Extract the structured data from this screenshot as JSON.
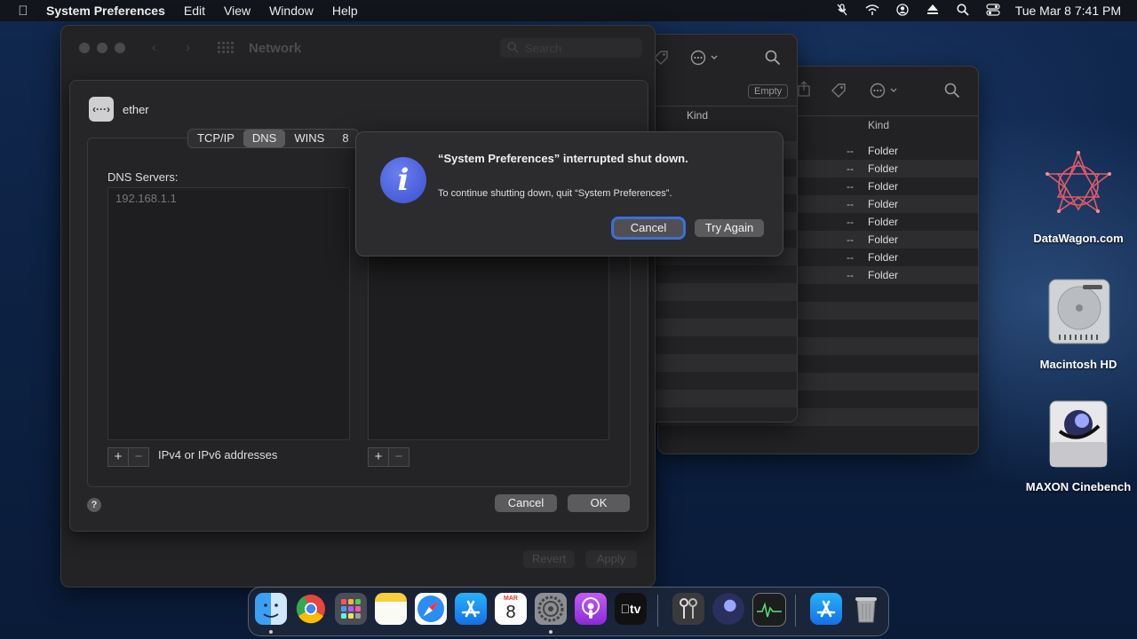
{
  "menubar": {
    "app_name": "System Preferences",
    "items": [
      "Edit",
      "View",
      "Window",
      "Help"
    ],
    "clock": "Tue Mar 8  7:41 PM",
    "status_icons": [
      "mic-muted-icon",
      "wifi-icon",
      "user-icon",
      "eject-icon",
      "spotlight-icon",
      "control-center-icon"
    ]
  },
  "network_window": {
    "title": "Network",
    "search_placeholder": "Search",
    "revert_label": "Revert",
    "apply_label": "Apply"
  },
  "sheet": {
    "interface_name": "ether",
    "tabs": [
      "TCP/IP",
      "DNS",
      "WINS",
      "8"
    ],
    "selected_tab": "DNS",
    "dns_servers_label": "DNS Servers:",
    "dns_servers": [
      "192.168.1.1"
    ],
    "address_hint": "IPv4 or IPv6 addresses",
    "cancel_label": "Cancel",
    "ok_label": "OK",
    "help_label": "?"
  },
  "finder_back": {
    "empty_label": "Empty",
    "kind_header": "Kind",
    "rows": [
      {
        "size": "--",
        "kind": "Folder"
      },
      {
        "size": "--",
        "kind": "Folder"
      },
      {
        "size": "--",
        "kind": "Folder"
      },
      {
        "size": "--",
        "kind": "Folder"
      },
      {
        "size": "--",
        "kind": "Folder"
      },
      {
        "size": "--",
        "kind": "Folder"
      },
      {
        "size": "--",
        "kind": "Folder"
      },
      {
        "size": "--",
        "kind": "Folder"
      }
    ]
  },
  "alert": {
    "title": "“System Preferences” interrupted shut down.",
    "message": "To continue shutting down, quit “System Preferences”.",
    "cancel_label": "Cancel",
    "try_again_label": "Try Again",
    "icon_glyph": "i"
  },
  "desktop": {
    "icons": [
      {
        "label": "DataWagon.com",
        "icon": "datawagon-logo-icon"
      },
      {
        "label": "Macintosh HD",
        "icon": "hard-drive-icon"
      },
      {
        "label": "MAXON Cinebench",
        "icon": "cinebench-disk-icon"
      }
    ]
  },
  "dock": {
    "calendar_month": "MAR",
    "calendar_day": "8",
    "tv_label": "tv",
    "apps": [
      "finder",
      "chrome",
      "launchpad",
      "notes",
      "safari",
      "app-store",
      "calendar",
      "system-preferences",
      "podcasts",
      "apple-tv",
      "keychain-access",
      "cinebench",
      "activity-monitor",
      "app-store-downloads",
      "trash"
    ]
  },
  "colors": {
    "accent": "#3d6fd6",
    "alert_icon": "#4a5be0",
    "window_bg": "#232325"
  }
}
